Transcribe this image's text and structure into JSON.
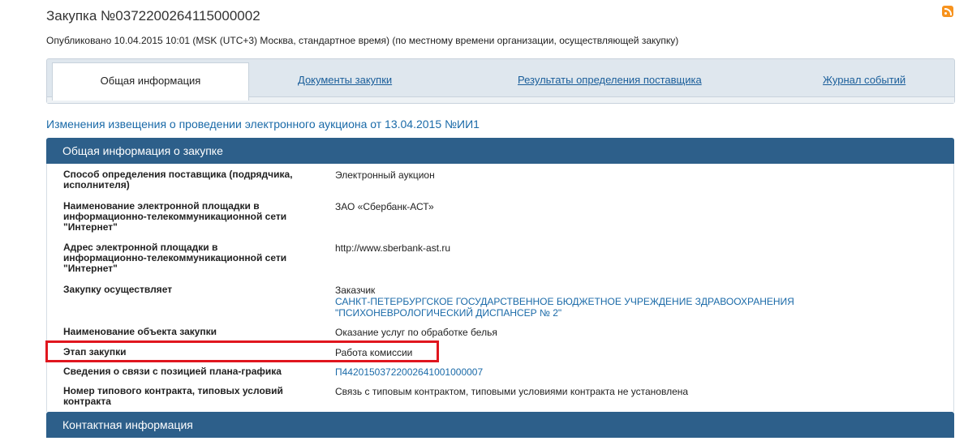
{
  "header": {
    "title": "Закупка №0372200264115000002",
    "rss_icon": "rss-icon",
    "published": "Опубликовано 10.04.2015 10:01 (MSK (UTC+3) Москва, стандартное время) (по местному времени организации, осуществляющей закупку)"
  },
  "tabs": [
    {
      "label": "Общая информация",
      "active": true
    },
    {
      "label": "Документы закупки",
      "active": false
    },
    {
      "label": "Результаты определения поставщика",
      "active": false
    },
    {
      "label": "Журнал событий",
      "active": false
    }
  ],
  "changes_link": "Изменения извещения о проведении электронного аукциона от 13.04.2015 №ИИ1",
  "general": {
    "section_title": "Общая информация о закупке",
    "rows": [
      {
        "label": "Способ определения поставщика (подрядчика, исполнителя)",
        "value": "Электронный аукцион"
      },
      {
        "label": "Наименование электронной площадки в информационно-телекоммуникационной сети \"Интернет\"",
        "value": "ЗАО «Сбербанк-АСТ»"
      },
      {
        "label": "Адрес электронной площадки в информационно-телекоммуникационной сети \"Интернет\"",
        "value": "http://www.sberbank-ast.ru"
      },
      {
        "label": "Закупку осуществляет",
        "value": "Заказчик",
        "org": "САНКТ-ПЕТЕРБУРГСКОЕ ГОСУДАРСТВЕННОЕ БЮДЖЕТНОЕ УЧРЕЖДЕНИЕ ЗДРАВООХРАНЕНИЯ \"ПСИХОНЕВРОЛОГИЧЕСКИЙ ДИСПАНСЕР № 2\""
      },
      {
        "label": "Наименование объекта закупки",
        "value": "Оказание услуг по обработке белья"
      },
      {
        "label": "Этап закупки",
        "value": "Работа комиссии"
      },
      {
        "label": "Сведения о связи с позицией плана-графика",
        "value": "П44201503722002641001000007"
      },
      {
        "label": "Номер типового контракта, типовых условий контракта",
        "value": "Связь с типовым контрактом, типовыми условиями контракта не установлена"
      }
    ]
  },
  "contacts": {
    "section_title": "Контактная информация"
  },
  "colors": {
    "section_header": "#2d5f8a",
    "link": "#1a6aa8",
    "highlight": "#e0161e"
  }
}
